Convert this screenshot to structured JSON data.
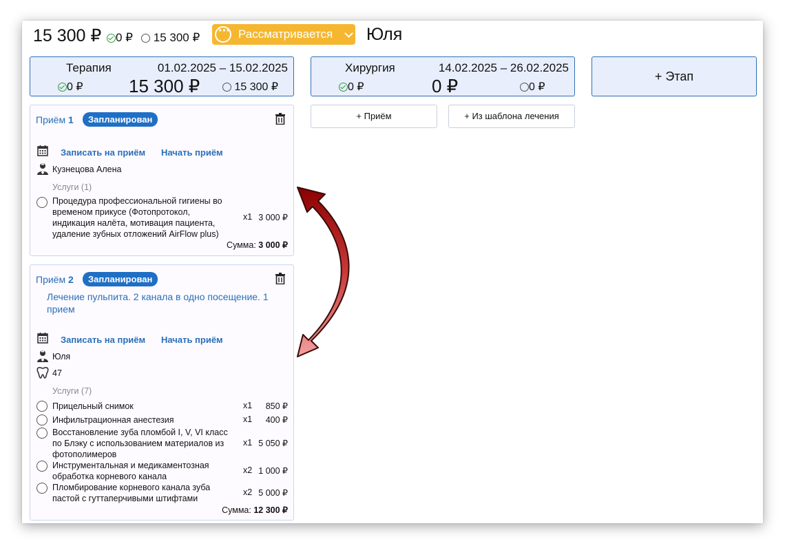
{
  "header": {
    "total": "15 300 ₽",
    "paid": "0 ₽",
    "remaining": "15 300 ₽",
    "status_label": "Рассматривается",
    "patient_name": "Юля",
    "status_color": "#f5b730"
  },
  "stages": [
    {
      "name": "Терапия",
      "dates": "01.02.2025 – 15.02.2025",
      "paid": "0 ₽",
      "total": "15 300 ₽",
      "remaining": "15 300 ₽"
    },
    {
      "name": "Хирургия",
      "dates": "14.02.2025 – 26.02.2025",
      "paid": "0 ₽",
      "total": "0 ₽",
      "remaining": "0 ₽"
    }
  ],
  "add_stage_label": "+ Этап",
  "surgery_actions": {
    "add_visit": "+ Приём",
    "from_template": "+ Из шаблона лечения"
  },
  "visits": [
    {
      "title": "Приём",
      "number": "1",
      "status": "Запланирован",
      "book_label": "Записать на приём",
      "start_label": "Начать приём",
      "doctor": "Кузнецова Алена",
      "services_header": "Услуги (1)",
      "services": [
        {
          "line1": "Процедура профессиональной гигиены во",
          "line2": "временом прикусе (Фотопротокол,",
          "line3": "индикация налёта, мотивация пациента,",
          "line4": "удаление зубных отложений AirFlow plus)",
          "qty": "x1",
          "price": "3 000 ₽"
        }
      ],
      "sum_label": "Сумма:",
      "sum_value": "3 000 ₽"
    },
    {
      "title": "Приём",
      "number": "2",
      "status": "Запланирован",
      "description": "Лечение пульпита. 2 канала в одно посещение. 1 прием",
      "book_label": "Записать на приём",
      "start_label": "Начать приём",
      "doctor": "Юля",
      "tooth": "47",
      "services_header": "Услуги (7)",
      "services": [
        {
          "line1": "Прицельный снимок",
          "qty": "x1",
          "price": "850 ₽"
        },
        {
          "line1": "Инфильтрационная анестезия",
          "qty": "x1",
          "price": "400 ₽"
        },
        {
          "line1": "Восстановление зуба пломбой I, V, VI класс",
          "line2": "по Блэку с использованием материалов из",
          "line3": "фотополимеров",
          "qty": "x1",
          "price": "5 050 ₽"
        },
        {
          "line1": "Инструментальная и медикаментозная",
          "line2": "обработка корневого канала",
          "qty": "x2",
          "price": "1 000 ₽"
        },
        {
          "line1": "Пломбирование корневого канала зуба",
          "line2": "пастой с гуттаперчивыми штифтами",
          "qty": "x2",
          "price": "5 000 ₽"
        }
      ],
      "sum_label": "Сумма:",
      "sum_value": "12 300 ₽"
    }
  ],
  "arrow_colors": {
    "dark": "#8b0000",
    "light": "#f4a0a0"
  }
}
